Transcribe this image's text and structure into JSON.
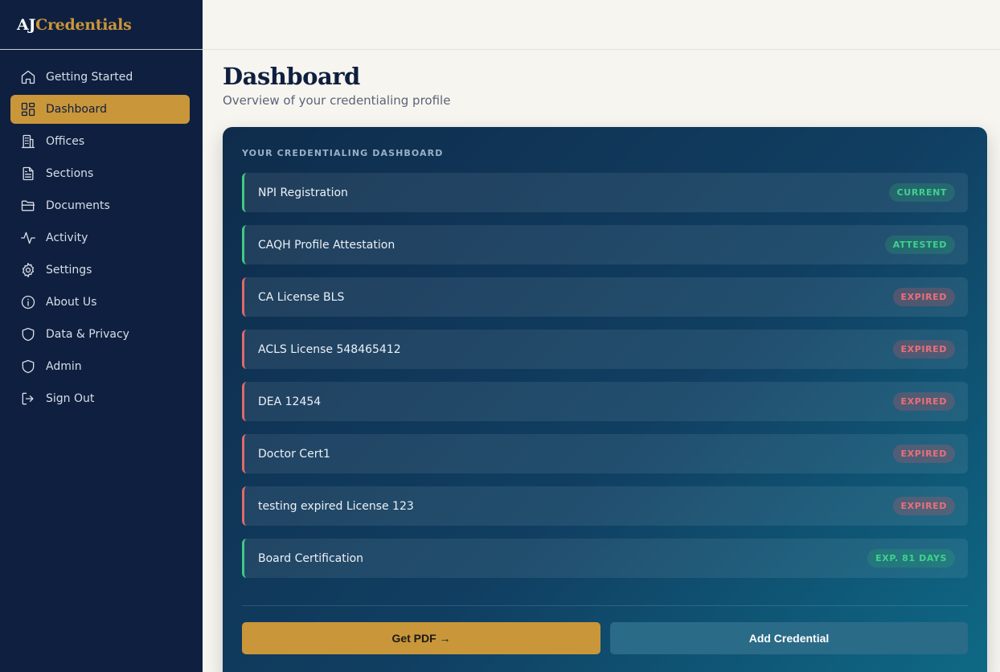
{
  "brand": {
    "part1": "AJ",
    "part2": "Credentials"
  },
  "nav": [
    {
      "label": "Getting Started",
      "icon": "home-icon"
    },
    {
      "label": "Dashboard",
      "icon": "dashboard-icon",
      "active": true
    },
    {
      "label": "Offices",
      "icon": "building-icon"
    },
    {
      "label": "Sections",
      "icon": "file-text-icon"
    },
    {
      "label": "Documents",
      "icon": "folder-icon"
    },
    {
      "label": "Activity",
      "icon": "activity-icon"
    },
    {
      "label": "Settings",
      "icon": "gear-icon"
    },
    {
      "label": "About Us",
      "icon": "info-icon"
    },
    {
      "label": "Data & Privacy",
      "icon": "shield-icon"
    },
    {
      "label": "Admin",
      "icon": "shield-icon"
    },
    {
      "label": "Sign Out",
      "icon": "sign-out-icon"
    }
  ],
  "page": {
    "title": "Dashboard",
    "subtitle": "Overview of your credentialing profile"
  },
  "card": {
    "heading": "YOUR CREDENTIALING DASHBOARD",
    "credentials": [
      {
        "name": "NPI Registration",
        "status": "CURRENT",
        "tone": "good"
      },
      {
        "name": "CAQH Profile Attestation",
        "status": "ATTESTED",
        "tone": "good"
      },
      {
        "name": "CA License BLS",
        "status": "EXPIRED",
        "tone": "bad"
      },
      {
        "name": "ACLS License 548465412",
        "status": "EXPIRED",
        "tone": "bad"
      },
      {
        "name": "DEA 12454",
        "status": "EXPIRED",
        "tone": "bad"
      },
      {
        "name": "Doctor Cert1",
        "status": "EXPIRED",
        "tone": "bad"
      },
      {
        "name": "testing expired License 123",
        "status": "EXPIRED",
        "tone": "bad"
      },
      {
        "name": "Board Certification",
        "status": "EXP. 81 DAYS",
        "tone": "good"
      }
    ],
    "get_pdf_label": "Get PDF →",
    "add_label": "Add Credential"
  },
  "colors": {
    "sidebar": "#0f1f3f",
    "accent": "#c9963a",
    "good": "#3fca83",
    "bad": "#e06a6a"
  }
}
